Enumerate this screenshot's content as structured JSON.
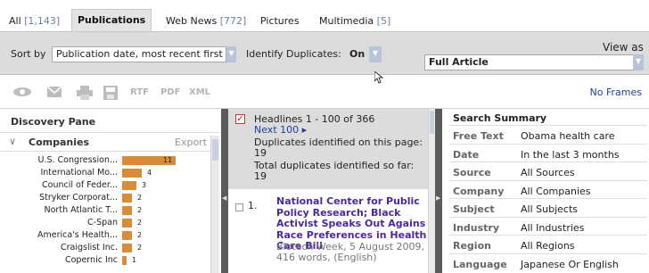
{
  "tabs": [
    {
      "label": "All",
      "count": "[1,143]"
    },
    {
      "label": "Publications",
      "count": ""
    },
    {
      "label": "Web News",
      "count": "[772]"
    },
    {
      "label": "Pictures",
      "count": ""
    },
    {
      "label": "Multimedia",
      "count": "[5]"
    }
  ],
  "sortbar": {
    "sort_label": "Sort by",
    "sort_value": "Publication date, most recent first",
    "dup_label": "Identify Duplicates:",
    "dup_value": "On",
    "view_label": "View as",
    "view_value": "Full Article"
  },
  "toolbar": {
    "rtf": "RTF",
    "pdf": "PDF",
    "xml": "XML",
    "no_frames": "No Frames",
    "icons": [
      "eye-icon",
      "email-icon",
      "print-icon",
      "save-icon"
    ]
  },
  "discovery": {
    "title": "Discovery Pane",
    "section": "Companies",
    "export": "Export",
    "bar_color": "#d98b3a",
    "companies": [
      {
        "name": "U.S. Congression...",
        "value": 11
      },
      {
        "name": "International Mo...",
        "value": 4
      },
      {
        "name": "Council of Feder...",
        "value": 3
      },
      {
        "name": "Stryker Corporat...",
        "value": 2
      },
      {
        "name": "North Atlantic T...",
        "value": 2
      },
      {
        "name": "C-Span",
        "value": 2
      },
      {
        "name": "America's Health...",
        "value": 2
      },
      {
        "name": "Craigslist Inc.",
        "value": 2
      },
      {
        "name": "Copernic Inc",
        "value": 1
      }
    ]
  },
  "headlines": {
    "range": "Headlines 1 - 100 of 366",
    "next": "Next 100 ▸",
    "dup_page_label": "Duplicates identified on this page:",
    "dup_page_value": "19",
    "dup_total_label": "Total duplicates identified so far:",
    "dup_total_value": "19",
    "items": [
      {
        "number": "1.",
        "title": "National Center for Public Policy Research; Black Activist Speaks Out Agains Race Preferences in Health Care Bill",
        "meta": "Biotech Week, 5 August 2009, 416 words, (English)"
      }
    ]
  },
  "summary": {
    "title": "Search Summary",
    "rows": [
      {
        "key": "Free Text",
        "value": "Obama health care"
      },
      {
        "key": "Date",
        "value": "In the last 3 months"
      },
      {
        "key": "Source",
        "value": "All Sources"
      },
      {
        "key": "Company",
        "value": "All Companies"
      },
      {
        "key": "Subject",
        "value": "All Subjects"
      },
      {
        "key": "Industry",
        "value": "All Industries"
      },
      {
        "key": "Region",
        "value": "All Regions"
      },
      {
        "key": "Language",
        "value": "Japanese Or English"
      }
    ]
  }
}
